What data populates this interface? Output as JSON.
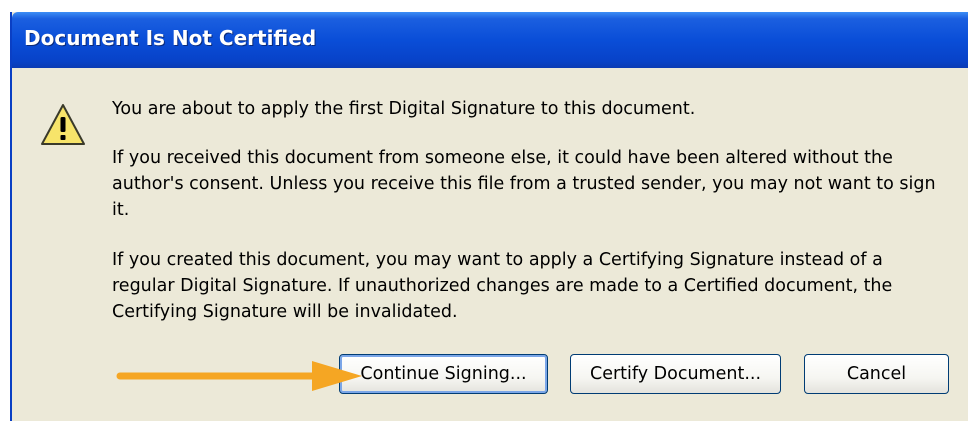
{
  "dialog": {
    "title": "Document Is Not Certified",
    "icon": "warning-icon",
    "messages": [
      "You are about to apply the first Digital Signature to this document.",
      "If you received this document from someone else, it could have been altered without the author's consent. Unless you receive this file from a trusted sender, you may not want to sign it.",
      "If you created this document, you may want to apply a Certifying Signature instead of a regular Digital Signature. If unauthorized changes are made to a Certified document, the Certifying Signature will be invalidated."
    ],
    "buttons": {
      "continue": "Continue Signing...",
      "certify": "Certify Document...",
      "cancel": "Cancel"
    }
  },
  "annotation": {
    "type": "arrow",
    "points_to": "continue-signing-button",
    "color": "#f5a623"
  },
  "colors": {
    "titlebar": "#0a4ed8",
    "dialog_background": "#ece9d8",
    "title_text": "#ffffff"
  }
}
